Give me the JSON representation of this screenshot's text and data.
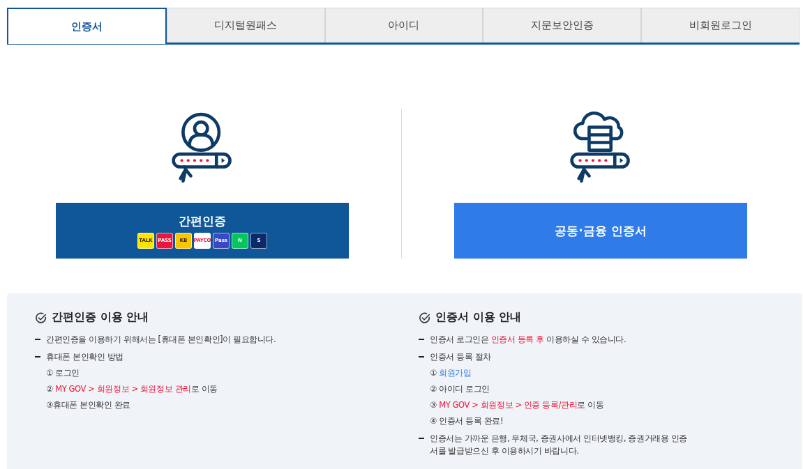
{
  "tabs": [
    {
      "label": "인증서",
      "selected": true
    },
    {
      "label": "디지털원패스",
      "selected": false
    },
    {
      "label": "아이디",
      "selected": false
    },
    {
      "label": "지문보안인증",
      "selected": false
    },
    {
      "label": "비회원로그인",
      "selected": false
    }
  ],
  "options": [
    {
      "kind": "simple",
      "label": "간편인증",
      "badges": [
        {
          "label": "TALK",
          "color": "#fee500"
        },
        {
          "label": "PASS",
          "color": "#e8173d"
        },
        {
          "label": "KB",
          "color": "#f7c600"
        },
        {
          "label": "PAYCO",
          "color": "#ffffff"
        },
        {
          "label": "Pass",
          "color": "#3749c4"
        },
        {
          "label": "N",
          "color": "#03c75a"
        },
        {
          "label": "S",
          "color": "#0b2a6b"
        }
      ]
    },
    {
      "kind": "certificate",
      "label": "공동·금융 인증서"
    }
  ],
  "guides": [
    {
      "title": "간편인증 이용 안내",
      "items": [
        {
          "kind": "bullet",
          "parts": [
            {
              "text": "간편인증을 이용하기 위해서는 [휴대폰 본인확인]이 필요합니다.",
              "kind": "plain"
            }
          ]
        },
        {
          "kind": "bullet",
          "parts": [
            {
              "text": "휴대폰 본인확인 방법",
              "kind": "plain"
            }
          ]
        },
        {
          "kind": "step",
          "parts": [
            {
              "text": "① 로그인",
              "kind": "plain"
            }
          ]
        },
        {
          "kind": "step",
          "parts": [
            {
              "text": "② ",
              "kind": "plain"
            },
            {
              "text": "MY GOV > 회원정보 > 회원정보 관리",
              "kind": "red"
            },
            {
              "text": "로 이동",
              "kind": "plain"
            }
          ]
        },
        {
          "kind": "step",
          "parts": [
            {
              "text": "③휴대폰 본인확인 완료",
              "kind": "plain"
            }
          ]
        }
      ]
    },
    {
      "title": "인증서 이용 안내",
      "items": [
        {
          "kind": "bullet",
          "parts": [
            {
              "text": "인증서 로그인은 ",
              "kind": "plain"
            },
            {
              "text": "인증서 등록 후",
              "kind": "red"
            },
            {
              "text": " 이용하실 수 있습니다.",
              "kind": "plain"
            }
          ]
        },
        {
          "kind": "bullet",
          "parts": [
            {
              "text": "인증서 등록 절차",
              "kind": "plain"
            }
          ]
        },
        {
          "kind": "step",
          "parts": [
            {
              "text": "① ",
              "kind": "plain"
            },
            {
              "text": "회원가입",
              "kind": "link"
            }
          ]
        },
        {
          "kind": "step",
          "parts": [
            {
              "text": "② 아이디 로그인",
              "kind": "plain"
            }
          ]
        },
        {
          "kind": "step",
          "parts": [
            {
              "text": "③ ",
              "kind": "plain"
            },
            {
              "text": "MY GOV > 회원정보 > 인증 등록/관리",
              "kind": "red"
            },
            {
              "text": "로 이동",
              "kind": "plain"
            }
          ]
        },
        {
          "kind": "step",
          "parts": [
            {
              "text": "④ 인증서 등록 완료!",
              "kind": "plain"
            }
          ]
        },
        {
          "kind": "bullet",
          "parts": [
            {
              "text": "인증서는 가까운 은행, 우체국, 증권사에서 인터넷뱅킹, 증권거래용 인증서를 발급받으신 후 이용하시기 바랍니다.",
              "kind": "plain"
            }
          ]
        }
      ]
    }
  ]
}
